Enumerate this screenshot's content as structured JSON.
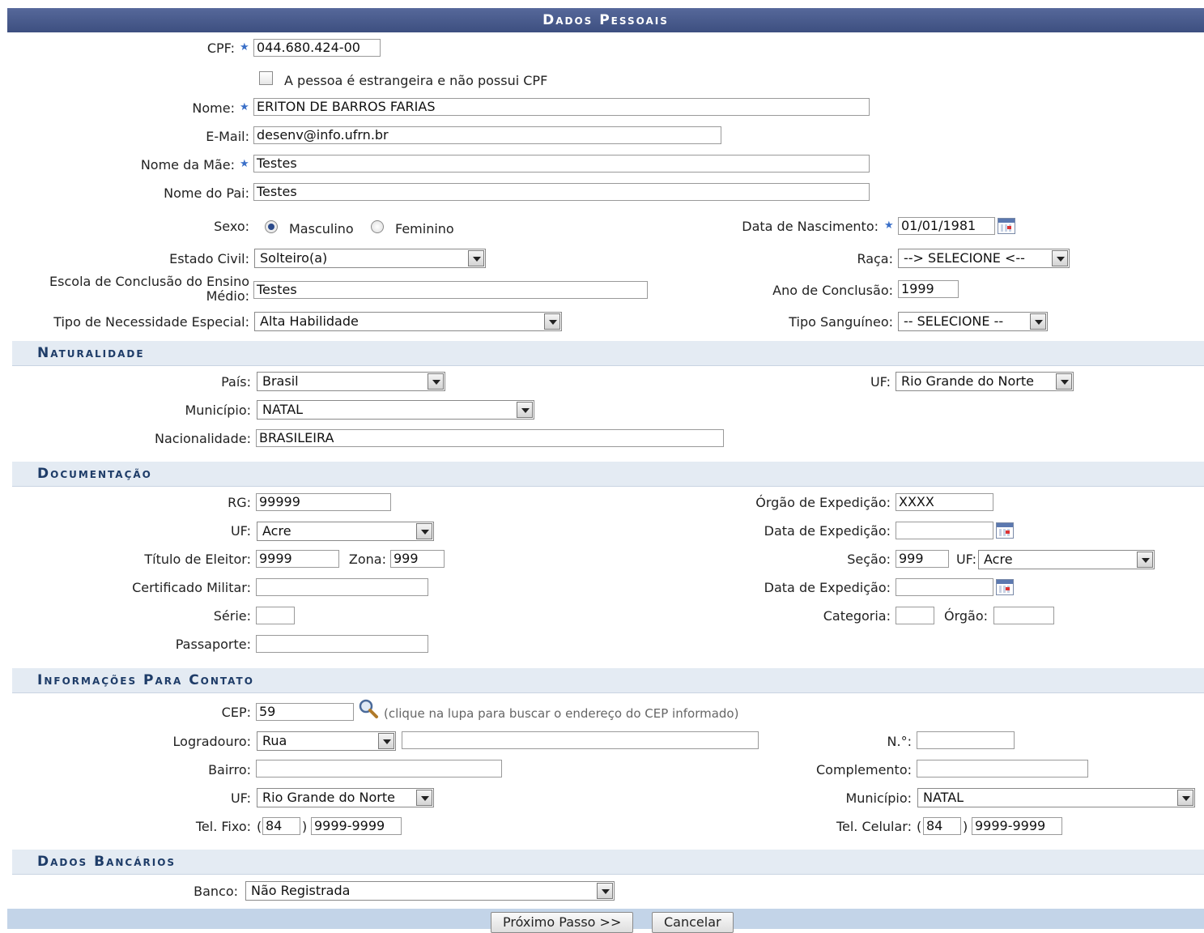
{
  "header": {
    "title": "Dados Pessoais"
  },
  "personal": {
    "cpf_label": "CPF:",
    "cpf_value": "044.680.424-00",
    "foreign_label": "A pessoa é estrangeira e não possui CPF",
    "nome_label": "Nome:",
    "nome_value": "ERITON DE BARROS FARIAS",
    "email_label": "E-Mail:",
    "email_value": "desenv@info.ufrn.br",
    "mae_label": "Nome da Mãe:",
    "mae_value": "Testes",
    "pai_label": "Nome do Pai:",
    "pai_value": "Testes",
    "sexo_label": "Sexo:",
    "sexo_m": "Masculino",
    "sexo_f": "Feminino",
    "nasc_label": "Data de Nascimento:",
    "nasc_value": "01/01/1981",
    "civil_label": "Estado Civil:",
    "civil_value": "Solteiro(a)",
    "raca_label": "Raça:",
    "raca_value": "--> SELECIONE <--",
    "escola_label_1": "Escola de Conclusão do Ensino",
    "escola_label_2": "Médio:",
    "escola_value": "Testes",
    "ano_label": "Ano de Conclusão:",
    "ano_value": "1999",
    "necessidade_label": "Tipo de Necessidade Especial:",
    "necessidade_value": "Alta Habilidade",
    "sangue_label": "Tipo Sanguíneo:",
    "sangue_value": "-- SELECIONE --"
  },
  "naturalidade": {
    "title": "Naturalidade",
    "pais_label": "País:",
    "pais_value": "Brasil",
    "uf_label": "UF:",
    "uf_value": "Rio Grande do Norte",
    "municipio_label": "Município:",
    "municipio_value": "NATAL",
    "nacionalidade_label": "Nacionalidade:",
    "nacionalidade_value": "BRASILEIRA"
  },
  "documentacao": {
    "title": "Documentação",
    "rg_label": "RG:",
    "rg_value": "99999",
    "orgao_label": "Órgão de Expedição:",
    "orgao_value": "XXXX",
    "uf_label": "UF:",
    "uf_value": "Acre",
    "data_exp_label": "Data de Expedição:",
    "data_exp_value": "",
    "titulo_label": "Título de Eleitor:",
    "titulo_value": "9999",
    "zona_label": "Zona:",
    "zona_value": "999",
    "secao_label": "Seção:",
    "secao_value": "999",
    "titulo_uf_label": "UF:",
    "titulo_uf_value": "Acre",
    "militar_label": "Certificado Militar:",
    "militar_value": "",
    "militar_data_label": "Data de Expedição:",
    "militar_data_value": "",
    "serie_label": "Série:",
    "serie_value": "",
    "categoria_label": "Categoria:",
    "categoria_value": "",
    "militar_orgao_label": "Órgão:",
    "militar_orgao_value": "",
    "passaporte_label": "Passaporte:",
    "passaporte_value": ""
  },
  "contato": {
    "title": "Informações Para Contato",
    "cep_label": "CEP:",
    "cep_value": "59",
    "cep_hint": "(clique na lupa para buscar o endereço do CEP informado)",
    "logradouro_label": "Logradouro:",
    "logradouro_tipo": "Rua",
    "logradouro_value": "",
    "numero_label": "N.°:",
    "numero_value": "",
    "bairro_label": "Bairro:",
    "bairro_value": "",
    "complemento_label": "Complemento:",
    "complemento_value": "",
    "uf_label": "UF:",
    "uf_value": "Rio Grande do Norte",
    "municipio_label": "Município:",
    "municipio_value": "NATAL",
    "fixo_label": "Tel. Fixo:",
    "fixo_ddd": "84",
    "fixo_num": "9999-9999",
    "celular_label": "Tel. Celular:",
    "celular_ddd": "84",
    "celular_num": "9999-9999",
    "open_paren": "(",
    "close_paren": ")"
  },
  "bancarios": {
    "title": "Dados Bancários",
    "banco_label": "Banco:",
    "banco_value": "Não Registrada"
  },
  "actions": {
    "next_label": "Próximo Passo >>",
    "cancel_label": "Cancelar"
  },
  "icons": {
    "required": "star-icon",
    "calendar": "calendar-icon",
    "search": "magnifier-icon",
    "dropdown": "chevron-down-icon"
  }
}
